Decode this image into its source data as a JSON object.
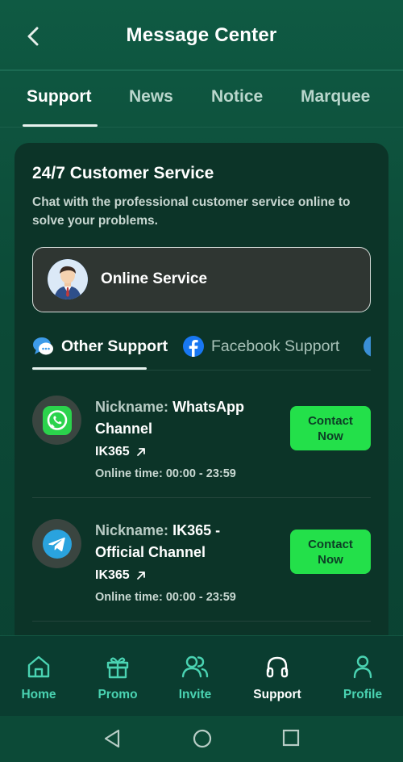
{
  "header": {
    "title": "Message Center"
  },
  "tabs": [
    {
      "label": "Support"
    },
    {
      "label": "News"
    },
    {
      "label": "Notice"
    },
    {
      "label": "Marquee"
    }
  ],
  "card": {
    "title": "24/7 Customer Service",
    "description": "Chat with the professional customer service online to solve your problems.",
    "online_service_label": "Online Service",
    "support_tabs": [
      {
        "label": "Other Support",
        "icon": "chat-bubbles-icon"
      },
      {
        "label": "Facebook Support",
        "icon": "facebook-icon"
      }
    ],
    "rows": [
      {
        "icon": "whatsapp-icon",
        "nickname_key": "Nickname:",
        "nickname_value": "WhatsApp Channel",
        "account": "IK365",
        "online_time": "Online time: 00:00 - 23:59",
        "button": "Contact Now"
      },
      {
        "icon": "telegram-icon",
        "nickname_key": "Nickname:",
        "nickname_value": "IK365 - Official Channel",
        "account": "IK365",
        "online_time": "Online time: 00:00 - 23:59",
        "button": "Contact Now"
      }
    ]
  },
  "bottom_nav": [
    {
      "label": "Home",
      "icon": "home-icon"
    },
    {
      "label": "Promo",
      "icon": "gift-icon"
    },
    {
      "label": "Invite",
      "icon": "users-icon"
    },
    {
      "label": "Support",
      "icon": "headphones-icon"
    },
    {
      "label": "Profile",
      "icon": "user-icon"
    }
  ],
  "colors": {
    "background": "#0c4a37",
    "card": "#0c3428",
    "accent_green": "#23e04a",
    "nav_teal": "#4ad3b2"
  }
}
